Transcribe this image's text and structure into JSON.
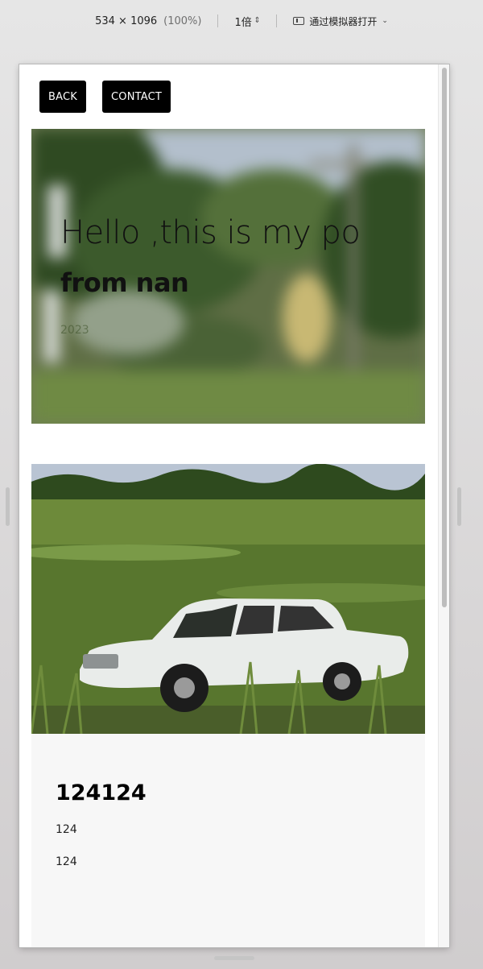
{
  "toolbar": {
    "dimensions": "534 × 1096",
    "zoom": "(100%)",
    "scale": "1倍",
    "open_in_simulator": "通过模拟器打开"
  },
  "nav": {
    "back_label": "BACK",
    "contact_label": "CONTACT"
  },
  "hero": {
    "title": "Hello ,this is my po",
    "subtitle": "from nan",
    "year": "2023"
  },
  "card": {
    "title": "124124",
    "line1": "124",
    "line2": "124"
  },
  "icons": {
    "scale_chevron": "chevron-up-down-icon",
    "simulator": "simulator-icon",
    "dropdown": "chevron-down-icon"
  }
}
